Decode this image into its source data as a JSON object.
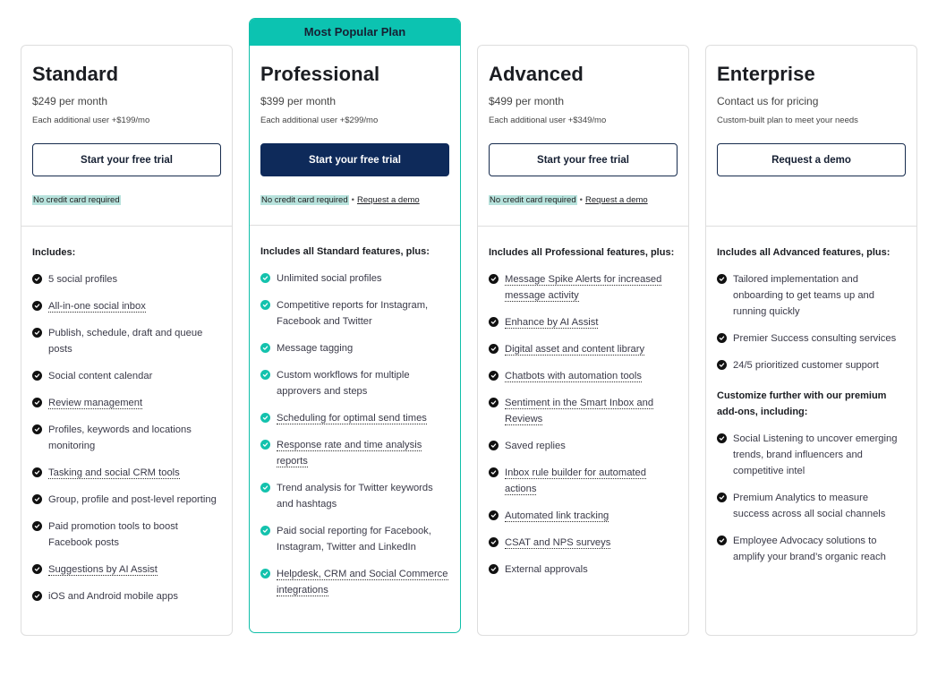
{
  "colors": {
    "accent_teal": "#0cc3b1",
    "primary_navy": "#0e2a5a",
    "check_dark": "#111111",
    "check_teal": "#14c2ad",
    "highlight": "#b7e2dc"
  },
  "plans": [
    {
      "name": "Standard",
      "price": "$249 per month",
      "subtext": "Each additional user +$199/mo",
      "cta": "Start your free trial",
      "cta_style": "outline",
      "fine_print": "No credit card required",
      "fine_link": null,
      "includes_heading": "Includes:",
      "features": [
        {
          "text": "5 social profiles",
          "tooltip": false
        },
        {
          "text": "All-in-one social inbox",
          "tooltip": true
        },
        {
          "text": "Publish, schedule, draft and queue posts",
          "tooltip": false
        },
        {
          "text": "Social content calendar",
          "tooltip": false
        },
        {
          "text": "Review management",
          "tooltip": true
        },
        {
          "text": "Profiles, keywords and locations monitoring",
          "tooltip": false
        },
        {
          "text": "Tasking and social CRM tools",
          "tooltip": true
        },
        {
          "text": "Group, profile and post-level reporting",
          "tooltip": false
        },
        {
          "text": "Paid promotion tools to boost Facebook posts",
          "tooltip": false
        },
        {
          "text": "Suggestions by AI Assist",
          "tooltip": true
        },
        {
          "text": "iOS and Android mobile apps",
          "tooltip": false
        }
      ]
    },
    {
      "badge": "Most Popular Plan",
      "name": "Professional",
      "price": "$399 per month",
      "subtext": "Each additional user +$299/mo",
      "cta": "Start your free trial",
      "cta_style": "primary",
      "fine_print": "No credit card required",
      "separator": "•",
      "fine_link": "Request a demo",
      "includes_heading": "Includes all Standard features, plus:",
      "features": [
        {
          "text": "Unlimited social profiles",
          "tooltip": false
        },
        {
          "text": "Competitive reports for Instagram, Facebook and Twitter",
          "tooltip": false
        },
        {
          "text": "Message tagging",
          "tooltip": false
        },
        {
          "text": "Custom workflows for multiple approvers and steps",
          "tooltip": false
        },
        {
          "text": "Scheduling for optimal send times",
          "tooltip": true
        },
        {
          "text": "Response rate and time analysis reports",
          "tooltip": true
        },
        {
          "text": "Trend analysis for Twitter keywords and hashtags",
          "tooltip": false
        },
        {
          "text": "Paid social reporting for Facebook, Instagram, Twitter and LinkedIn",
          "tooltip": false
        },
        {
          "text": "Helpdesk, CRM and Social Commerce integrations",
          "tooltip": true
        }
      ]
    },
    {
      "name": "Advanced",
      "price": "$499 per month",
      "subtext": "Each additional user +$349/mo",
      "cta": "Start your free trial",
      "cta_style": "outline",
      "fine_print": "No credit card required",
      "separator": "•",
      "fine_link": "Request a demo",
      "includes_heading": "Includes all Professional features, plus:",
      "features": [
        {
          "text": "Message Spike Alerts for increased message activity",
          "tooltip": true
        },
        {
          "text": "Enhance by AI Assist",
          "tooltip": true
        },
        {
          "text": "Digital asset and content library",
          "tooltip": true
        },
        {
          "text": "Chatbots with automation tools",
          "tooltip": true
        },
        {
          "text": "Sentiment in the Smart Inbox and Reviews",
          "tooltip": true
        },
        {
          "text": "Saved replies",
          "tooltip": false
        },
        {
          "text": "Inbox rule builder for automated actions",
          "tooltip": true
        },
        {
          "text": "Automated link tracking",
          "tooltip": true
        },
        {
          "text": "CSAT and NPS surveys",
          "tooltip": true
        },
        {
          "text": "External approvals",
          "tooltip": false
        }
      ]
    },
    {
      "name": "Enterprise",
      "price": "Contact us for pricing",
      "subtext": "Custom-built plan to meet your needs",
      "cta": "Request a demo",
      "cta_style": "outline",
      "fine_print": null,
      "fine_link": null,
      "includes_heading": "Includes all Advanced features, plus:",
      "features": [
        {
          "text": "Tailored implementation and onboarding to get teams up and running quickly",
          "tooltip": false
        },
        {
          "text": "Premier Success consulting services",
          "tooltip": false
        },
        {
          "text": "24/5 prioritized customer support",
          "tooltip": false
        }
      ],
      "addons_heading": "Customize further with our premium add-ons, including:",
      "addons": [
        {
          "text": "Social Listening to uncover emerging trends, brand influencers and competitive intel",
          "tooltip": false
        },
        {
          "text": "Premium Analytics to measure success across all social channels",
          "tooltip": false
        },
        {
          "text": "Employee Advocacy solutions to amplify your brand’s organic reach",
          "tooltip": false
        }
      ]
    }
  ]
}
